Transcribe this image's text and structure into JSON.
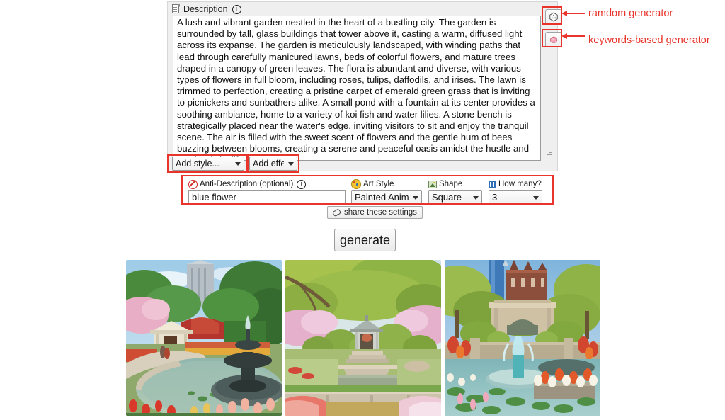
{
  "description_panel": {
    "header_label": "Description",
    "header_icon": "document-icon",
    "info_icon": "info-circle-icon",
    "text": "A lush and vibrant garden nestled in the heart of a bustling city. The garden is surrounded by tall, glass buildings that tower above it, casting a warm, diffused light across its expanse. The garden is meticulously landscaped, with winding paths that lead through carefully manicured lawns, beds of colorful flowers, and mature trees draped in a canopy of green leaves. The flora is abundant and diverse, with various types of flowers in full bloom, including roses, tulips, daffodils, and irises. The lawn is trimmed to perfection, creating a pristine carpet of emerald green grass that is inviting to picnickers and sunbathers alike. A small pond with a fountain at its center provides a soothing ambiance, home to a variety of koi fish and water lilies. A stone bench is strategically placed near the water's edge, inviting visitors to sit and enjoy the tranquil scene. The air is filled with the sweet scent of flowers and the gentle hum of bees buzzing between blooms, creating a serene and peaceful oasis amidst the hustle and bustle of city life."
  },
  "generator_buttons": {
    "random": {
      "icon": "dice-icon",
      "annotation": "ramdom generator"
    },
    "keywords": {
      "icon": "rose-blob-icon",
      "annotation": "keywords-based generator"
    }
  },
  "modifiers": {
    "style_select": "Add style...",
    "effect_select": "Add effect..."
  },
  "settings": {
    "anti_description": {
      "label": "Anti-Description (optional)",
      "icon": "no-entry-icon",
      "info_icon": "info-circle-icon",
      "value": "blue flower",
      "placeholder": ""
    },
    "art_style": {
      "label": "Art Style",
      "icon": "palette-icon",
      "value": "Painted Anime"
    },
    "shape": {
      "label": "Shape",
      "icon": "picture-icon",
      "value": "Square"
    },
    "how_many": {
      "label": "How many?",
      "icon": "number-icon",
      "value": "3"
    }
  },
  "share": {
    "label": "share these settings",
    "icon": "link-icon"
  },
  "generate": {
    "label": "generate"
  },
  "results": [
    {
      "alt": "Garden with tiered fountain, pond, pavilion and city skyscraper"
    },
    {
      "alt": "Symmetric garden with gazebo, cherry blossoms and stone steps"
    },
    {
      "alt": "Garden with arched stone gate, jet fountain and lily pond"
    }
  ],
  "annotation_color": "#e8342a"
}
